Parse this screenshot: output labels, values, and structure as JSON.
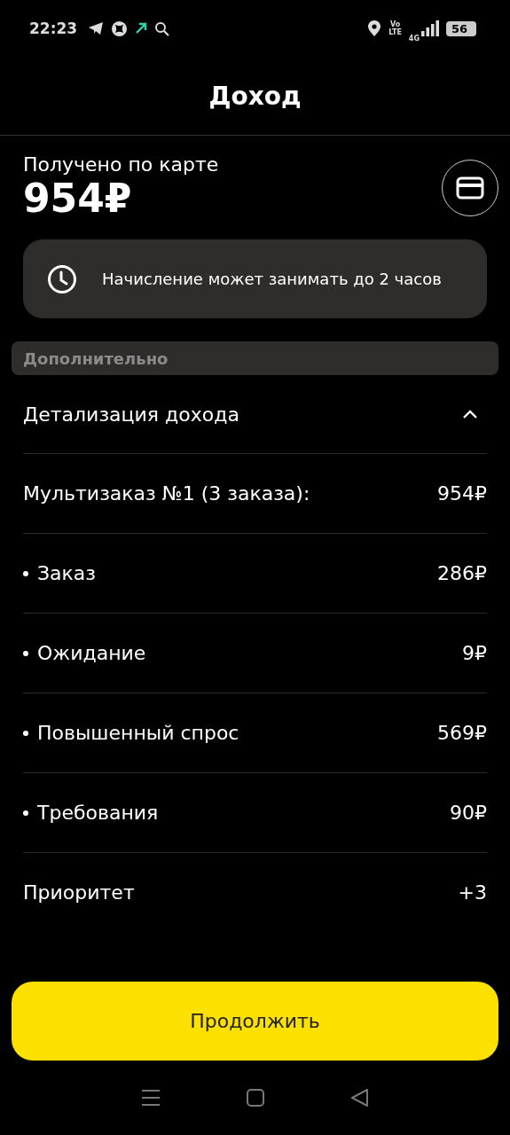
{
  "status_bar": {
    "time": "22:23",
    "volte_top": "Vo",
    "volte_bottom": "LTE",
    "network": "4G",
    "battery": "56"
  },
  "header": {
    "title": "Доход"
  },
  "summary": {
    "label": "Получено по карте",
    "amount": "954₽"
  },
  "notice": {
    "text": "Начисление может занимать до 2 часов"
  },
  "section": {
    "title": "Дополнительно"
  },
  "details": {
    "title": "Детализация дохода",
    "expanded": true,
    "rows": [
      {
        "kind": "total",
        "label": "Мультизаказ №1 (3 заказа):",
        "value": "954₽"
      },
      {
        "kind": "sub",
        "label": "Заказ",
        "value": "286₽"
      },
      {
        "kind": "sub",
        "label": "Ожидание",
        "value": "9₽"
      },
      {
        "kind": "sub",
        "label": "Повышенный спрос",
        "value": "569₽"
      },
      {
        "kind": "sub",
        "label": "Требования",
        "value": "90₽"
      },
      {
        "kind": "plain",
        "label": "Приоритет",
        "value": "+3"
      }
    ]
  },
  "continue_button": "Продолжить"
}
